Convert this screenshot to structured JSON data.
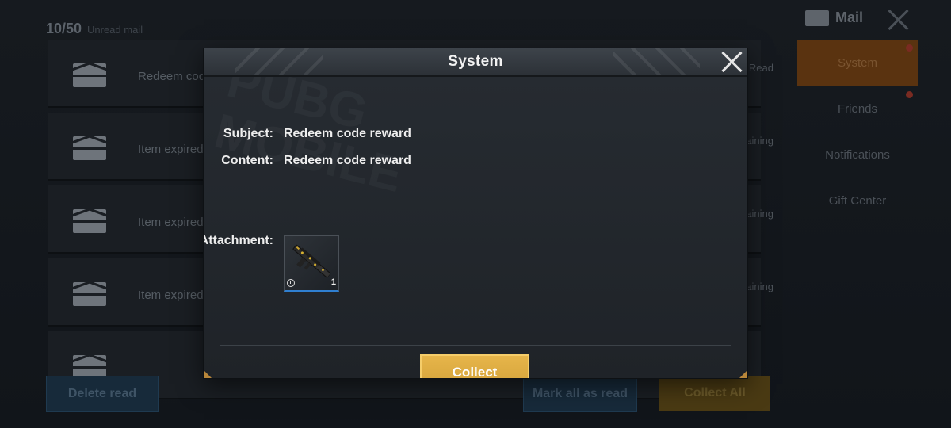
{
  "background": {
    "count": "10/50",
    "count_sub": "Unread mail",
    "mail_title": "Mail",
    "tabs": [
      {
        "label": "System",
        "active": true
      },
      {
        "label": "Friends",
        "active": false
      },
      {
        "label": "Notifications",
        "active": false
      },
      {
        "label": "Gift Center",
        "active": false
      }
    ],
    "rows": [
      {
        "title": "Redeem code",
        "right": "Read"
      },
      {
        "title": "Item expired",
        "right": "Remaining"
      },
      {
        "title": "Item expired",
        "right": "Remaining"
      },
      {
        "title": "Item expired",
        "right": "Remaining"
      },
      {
        "title": "",
        "right": ""
      }
    ],
    "buttons": {
      "delete_read": "Delete read",
      "mark_all_read": "Mark all as read",
      "collect_all": "Collect All"
    }
  },
  "modal": {
    "title": "System",
    "subject_label": "Subject:",
    "subject_value": "Redeem code reward",
    "content_label": "Content:",
    "content_value": "Redeem code reward",
    "attachment_label": "Attachment:",
    "attachment": {
      "item_icon": "rifle-skin-icon",
      "quantity": "1",
      "timed": true
    },
    "collect_label": "Collect"
  },
  "colors": {
    "accent_gold": "#dcaa42",
    "panel": "#23282e",
    "attachment_underline": "#2f7fd0"
  }
}
